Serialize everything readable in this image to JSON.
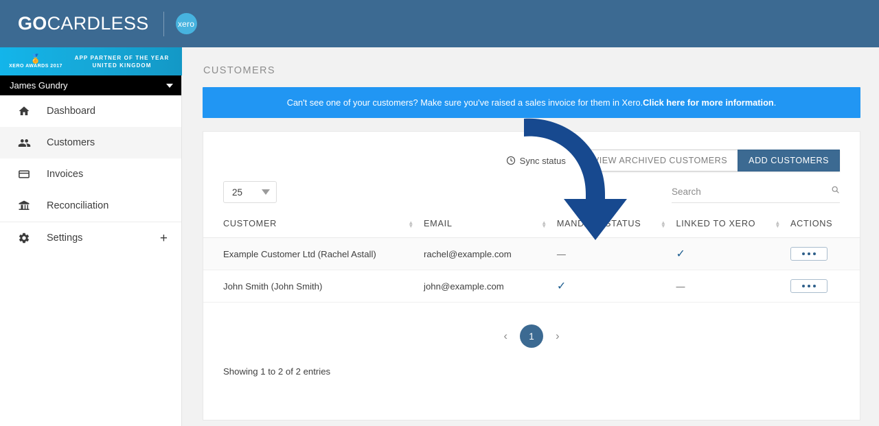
{
  "brand": {
    "name_bold": "GO",
    "name_light": "CARDLESS",
    "partner_logo": "xero"
  },
  "sidebar": {
    "award": {
      "medal_icon": "award-medal-icon",
      "left_text": "XERO AWARDS 2017",
      "right_line1": "APP PARTNER OF THE YEAR",
      "right_line2": "UNITED KINGDOM"
    },
    "user": {
      "name": "James Gundry",
      "caret_icon": "chevron-down-icon"
    },
    "items": [
      {
        "label": "Dashboard",
        "icon": "home-icon",
        "active": false
      },
      {
        "label": "Customers",
        "icon": "people-icon",
        "active": true
      },
      {
        "label": "Invoices",
        "icon": "credit-card-icon",
        "active": false
      },
      {
        "label": "Reconciliation",
        "icon": "bank-icon",
        "active": false
      },
      {
        "label": "Settings",
        "icon": "gear-icon",
        "active": false,
        "trailing_icon": "plus-icon",
        "trailing_label": "+"
      }
    ]
  },
  "main": {
    "page_title": "CUSTOMERS",
    "banner": {
      "text_before": "Can't see one of your customers? Make sure you've raised a sales invoice for them in Xero. ",
      "link_text": "Click here for more information",
      "text_after": ".",
      "color": "#2196f3"
    },
    "toolbar": {
      "sync_status_label": "Sync status",
      "sync_icon": "clock-icon",
      "view_archived_label": "VIEW ARCHIVED CUSTOMERS",
      "add_customers_label": "ADD CUSTOMERS",
      "primary_color": "#3c6a92"
    },
    "controls": {
      "page_size_value": "25",
      "page_size_caret": "chevron-down-icon",
      "search_placeholder": "Search",
      "search_value": "",
      "search_icon": "search-icon"
    },
    "table": {
      "columns": [
        {
          "label": "CUSTOMER",
          "sortable": true
        },
        {
          "label": "EMAIL",
          "sortable": true
        },
        {
          "label": "MANDATE STATUS",
          "sortable": true
        },
        {
          "label": "LINKED TO XERO",
          "sortable": true
        },
        {
          "label": "ACTIONS",
          "sortable": false
        }
      ],
      "rows": [
        {
          "customer": "Example Customer Ltd (Rachel Astall)",
          "email": "rachel@example.com",
          "mandate_status": "—",
          "mandate_status_type": "dash",
          "linked_to_xero": "✓",
          "linked_to_xero_type": "tick",
          "actions_icon": "ellipsis-icon"
        },
        {
          "customer": "John Smith (John Smith)",
          "email": "john@example.com",
          "mandate_status": "✓",
          "mandate_status_type": "tick",
          "linked_to_xero": "—",
          "linked_to_xero_type": "dash",
          "actions_icon": "ellipsis-icon"
        }
      ]
    },
    "pagination": {
      "prev_icon": "chevron-left-icon",
      "prev_label": "‹",
      "current_page": "1",
      "next_icon": "chevron-right-icon",
      "next_label": "›"
    },
    "entries_text": "Showing 1 to 2 of 2 entries"
  },
  "annotation": {
    "arrow_icon": "curved-down-arrow-annotation",
    "color": "#17498f"
  }
}
